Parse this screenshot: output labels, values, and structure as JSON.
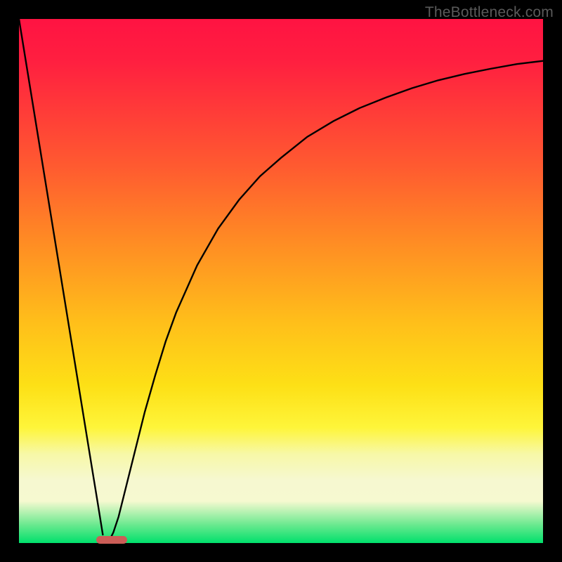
{
  "watermark": "TheBottleneck.com",
  "accent_color": "#cb5d57",
  "chart_data": {
    "type": "line",
    "title": "",
    "xlabel": "",
    "ylabel": "",
    "xlim": [
      0,
      100
    ],
    "ylim": [
      0,
      100
    ],
    "grid": false,
    "x": [
      0,
      2,
      4,
      6,
      8,
      10,
      12,
      14,
      15,
      16,
      17,
      18,
      19,
      20,
      22,
      24,
      26,
      28,
      30,
      34,
      38,
      42,
      46,
      50,
      55,
      60,
      65,
      70,
      75,
      80,
      85,
      90,
      95,
      100
    ],
    "series": [
      {
        "name": "left-line",
        "values": [
          100,
          87.7,
          75.4,
          63.1,
          50.8,
          38.5,
          26.2,
          13.9,
          7.8,
          1.6,
          null,
          null,
          null,
          null,
          null,
          null,
          null,
          null,
          null,
          null,
          null,
          null,
          null,
          null,
          null,
          null,
          null,
          null,
          null,
          null,
          null,
          null,
          null,
          null
        ]
      },
      {
        "name": "right-curve",
        "values": [
          null,
          null,
          null,
          null,
          null,
          null,
          null,
          null,
          null,
          null,
          0.0,
          2.0,
          5.0,
          9.0,
          17.0,
          25.0,
          32.0,
          38.5,
          44.0,
          53.0,
          60.0,
          65.5,
          70.0,
          73.5,
          77.5,
          80.5,
          83.0,
          85.0,
          86.8,
          88.3,
          89.5,
          90.5,
          91.4,
          92.0
        ]
      }
    ],
    "marker": {
      "x_start": 14.8,
      "x_end": 20.6,
      "y": 0.7
    }
  }
}
